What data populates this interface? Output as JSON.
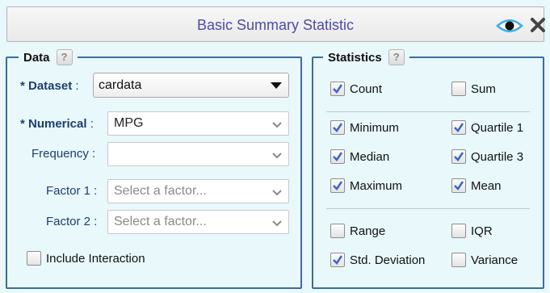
{
  "window": {
    "title": "Basic Summary Statistic"
  },
  "data_panel": {
    "legend": "Data",
    "help": "?",
    "dataset": {
      "label": "* Dataset",
      "colon": ":",
      "value": "cardata"
    },
    "numerical": {
      "label": "* Numerical",
      "colon": ":",
      "value": "MPG"
    },
    "frequency": {
      "label": "Frequency :",
      "value": ""
    },
    "factor1": {
      "label": "Factor 1 :",
      "placeholder": "Select a factor..."
    },
    "factor2": {
      "label": "Factor 2 :",
      "placeholder": "Select a factor..."
    },
    "include_interaction": {
      "label": "Include Interaction",
      "checked": false
    }
  },
  "stats_panel": {
    "legend": "Statistics",
    "help": "?",
    "items": [
      {
        "label": "Count",
        "checked": true
      },
      {
        "label": "Sum",
        "checked": false
      },
      {
        "label": "Minimum",
        "checked": true
      },
      {
        "label": "Quartile 1",
        "checked": true
      },
      {
        "label": "Median",
        "checked": true
      },
      {
        "label": "Quartile 3",
        "checked": true
      },
      {
        "label": "Maximum",
        "checked": true
      },
      {
        "label": "Mean",
        "checked": true
      },
      {
        "label": "Range",
        "checked": false
      },
      {
        "label": "IQR",
        "checked": false
      },
      {
        "label": "Std. Deviation",
        "checked": true
      },
      {
        "label": "Variance",
        "checked": false
      }
    ]
  },
  "colors": {
    "title": "#4d4ba3",
    "frame": "#3d6d9c",
    "check": "#3b67c9",
    "background": "#e8f8fb"
  }
}
